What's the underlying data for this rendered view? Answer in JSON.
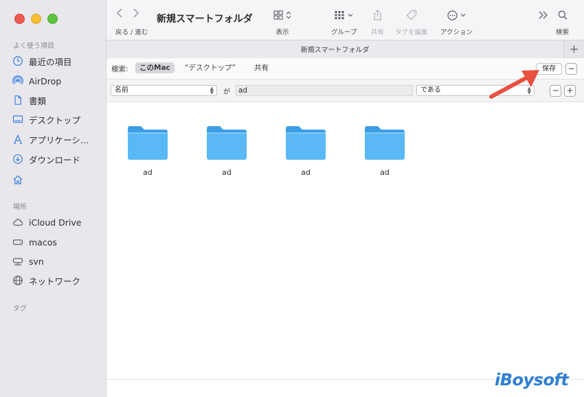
{
  "window": {
    "title": "新規スマートフォルダ"
  },
  "sidebar": {
    "favorites_title": "よく使う項目",
    "favorites": [
      {
        "label": "最近の項目",
        "icon": "clock-icon"
      },
      {
        "label": "AirDrop",
        "icon": "airdrop-icon"
      },
      {
        "label": "書類",
        "icon": "document-icon"
      },
      {
        "label": "デスクトップ",
        "icon": "desktop-icon"
      },
      {
        "label": "アプリケーシ…",
        "icon": "applications-icon"
      },
      {
        "label": "ダウンロード",
        "icon": "download-icon"
      },
      {
        "label": "",
        "icon": "home-icon"
      }
    ],
    "locations_title": "場所",
    "locations": [
      {
        "label": "iCloud Drive",
        "icon": "cloud-icon"
      },
      {
        "label": "macos",
        "icon": "drive-icon"
      },
      {
        "label": "svn",
        "icon": "network-drive-icon"
      },
      {
        "label": "ネットワーク",
        "icon": "globe-icon"
      }
    ],
    "tags_title": "タグ"
  },
  "toolbar": {
    "nav_label": "戻る / 進む",
    "view_label": "表示",
    "group_label": "グループ",
    "share_label": "共有",
    "tags_label": "タグを編集",
    "action_label": "アクション",
    "search_label": "検索"
  },
  "tabbar": {
    "title": "新規スマートフォルダ",
    "plus": "+"
  },
  "scope": {
    "label": "検索:",
    "options": [
      "このMac",
      "“デスクトップ”",
      "共有"
    ],
    "save_label": "保存",
    "minus": "−"
  },
  "criteria": {
    "attribute": "名前",
    "connector": "が",
    "value": "ad",
    "operator": "である",
    "minus": "−",
    "plus": "+"
  },
  "files": [
    {
      "name": "ad"
    },
    {
      "name": "ad"
    },
    {
      "name": "ad"
    },
    {
      "name": "ad"
    }
  ],
  "colors": {
    "folder": "#5ab8f5",
    "folder_tab": "#3d9ee6",
    "arrow": "#e8513f",
    "watermark": "#2f7fd0"
  },
  "watermark": {
    "text": "iBoysoft"
  }
}
